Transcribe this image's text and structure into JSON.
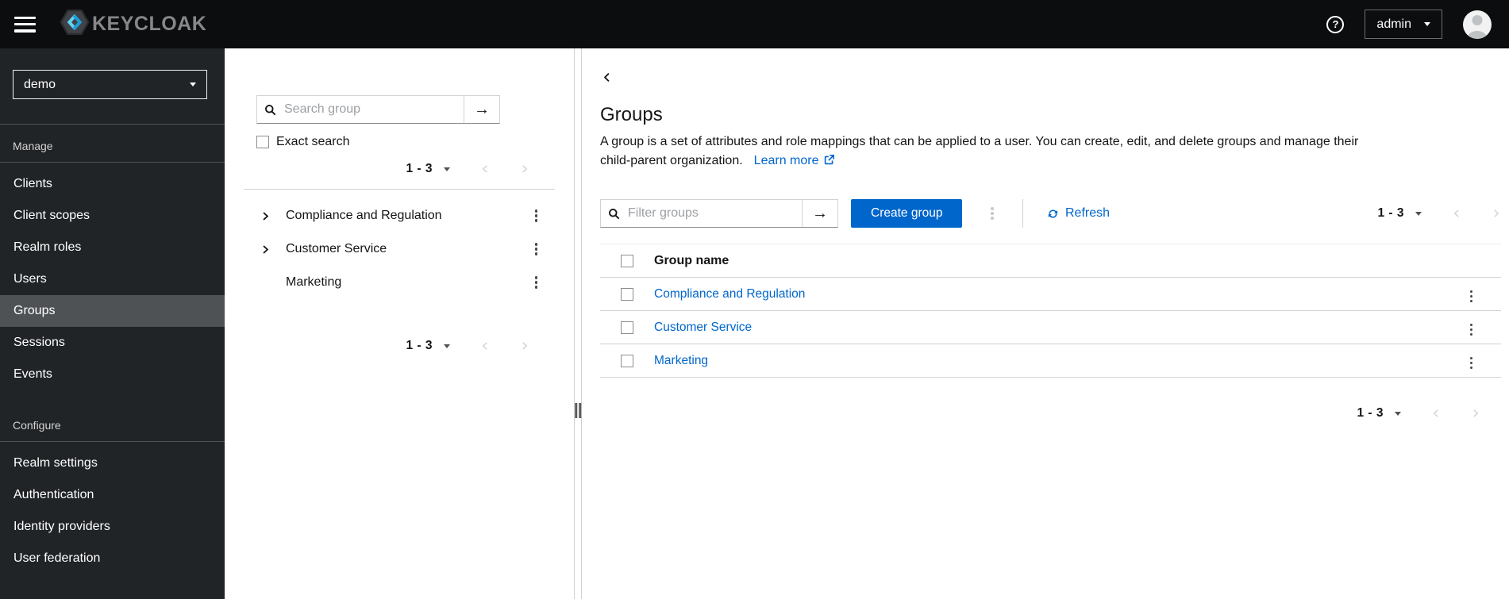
{
  "icons": {
    "arrow_right": "→",
    "question_mark": "?"
  },
  "colors": {
    "primary": "#0066cc",
    "link": "#0066cc",
    "topbar_bg": "#0b0d0e",
    "sidebar_bg": "#212427",
    "sidebar_selected_bg": "#4f5255",
    "border": "#d2d2d2"
  },
  "topbar": {
    "brand_text": "KEYCLOAK",
    "username": "admin"
  },
  "sidebar": {
    "realm": "demo",
    "sections": [
      {
        "label": "Manage",
        "items": [
          {
            "label": "Clients"
          },
          {
            "label": "Client scopes"
          },
          {
            "label": "Realm roles"
          },
          {
            "label": "Users"
          },
          {
            "label": "Groups",
            "selected": true
          },
          {
            "label": "Sessions"
          },
          {
            "label": "Events"
          }
        ]
      },
      {
        "label": "Configure",
        "items": [
          {
            "label": "Realm settings"
          },
          {
            "label": "Authentication"
          },
          {
            "label": "Identity providers"
          },
          {
            "label": "User federation"
          }
        ]
      }
    ]
  },
  "tree_panel": {
    "search_placeholder": "Search group",
    "exact_search_label": "Exact search",
    "pagination_range": "1 - 3",
    "groups": [
      {
        "name": "Compliance and Regulation",
        "expandable": true
      },
      {
        "name": "Customer Service",
        "expandable": true
      },
      {
        "name": "Marketing",
        "expandable": false
      }
    ]
  },
  "main": {
    "title": "Groups",
    "description_lines": [
      "A group is a set of attributes and role mappings that can be applied to a user. You can create, edit, and delete groups and manage their",
      "child-parent organization."
    ],
    "learn_more_label": "Learn more",
    "toolbar": {
      "filter_placeholder": "Filter groups",
      "create_label": "Create group",
      "refresh_label": "Refresh",
      "pagination_range": "1 - 3"
    },
    "table": {
      "name_header": "Group name",
      "rows": [
        {
          "name": "Compliance and Regulation"
        },
        {
          "name": "Customer Service"
        },
        {
          "name": "Marketing"
        }
      ],
      "pagination_range": "1 - 3"
    }
  }
}
